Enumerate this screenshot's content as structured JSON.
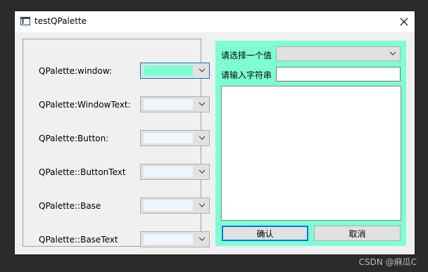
{
  "window": {
    "title": "testQPalette",
    "icon": "app-window-icon",
    "close_icon": "close-icon"
  },
  "palette_rows": [
    {
      "label": "QPalette:window:",
      "swatch_color": "#7fffd4",
      "focused": true
    },
    {
      "label": "QPalette:WindowText:",
      "swatch_color": "#eef6fd",
      "focused": false
    },
    {
      "label": "QPalette:Button:",
      "swatch_color": "#eef6fd",
      "focused": false
    },
    {
      "label": "QPalette::ButtonText",
      "swatch_color": "#eef6fd",
      "focused": false
    },
    {
      "label": "QPalette::Base",
      "swatch_color": "#eef6fd",
      "focused": false
    },
    {
      "label": "QPalette::BaseText",
      "swatch_color": "#eef6fd",
      "focused": false
    }
  ],
  "right_panel": {
    "background": "#7fffd4",
    "select_label": "请选择一个值",
    "select_value": "",
    "input_label": "请输入字符串",
    "input_value": "",
    "textarea_value": "",
    "ok_label": "确认",
    "cancel_label": "取消"
  },
  "watermark": "CSDN @麻瓜C"
}
